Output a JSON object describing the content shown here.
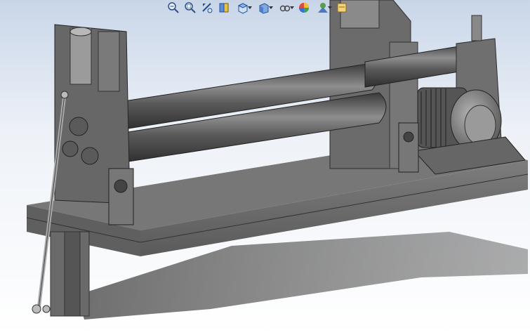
{
  "app": {
    "view": "3d-model-viewport"
  },
  "heads_up_toolbar": {
    "tools": [
      {
        "name": "zoom-to-fit",
        "icon": "zoom-to-fit-icon",
        "has_menu": false
      },
      {
        "name": "zoom-to-area",
        "icon": "zoom-to-area-icon",
        "has_menu": false
      },
      {
        "name": "previous-view",
        "icon": "previous-view-icon",
        "has_menu": false
      },
      {
        "name": "section-view",
        "icon": "section-view-icon",
        "has_menu": false
      },
      {
        "name": "view-orientation",
        "icon": "view-orientation-icon",
        "has_menu": true
      },
      {
        "name": "display-style",
        "icon": "display-style-icon",
        "has_menu": true
      },
      {
        "name": "hide-show-items",
        "icon": "hide-show-items-icon",
        "has_menu": true
      },
      {
        "name": "edit-appearance",
        "icon": "edit-appearance-icon",
        "has_menu": false
      },
      {
        "name": "apply-scene",
        "icon": "apply-scene-icon",
        "has_menu": true
      },
      {
        "name": "view-settings",
        "icon": "view-settings-icon",
        "has_menu": false
      }
    ]
  },
  "colors": {
    "background_top": "#c9d6e8",
    "background_bottom": "#ffffff",
    "steel_light": "#9a9a9a",
    "steel_mid": "#6f6f6f",
    "steel_dark": "#3c3c3c",
    "shadow": "#4a4a4a"
  },
  "model": {
    "description_icon": "plate-rolling-machine-model"
  }
}
